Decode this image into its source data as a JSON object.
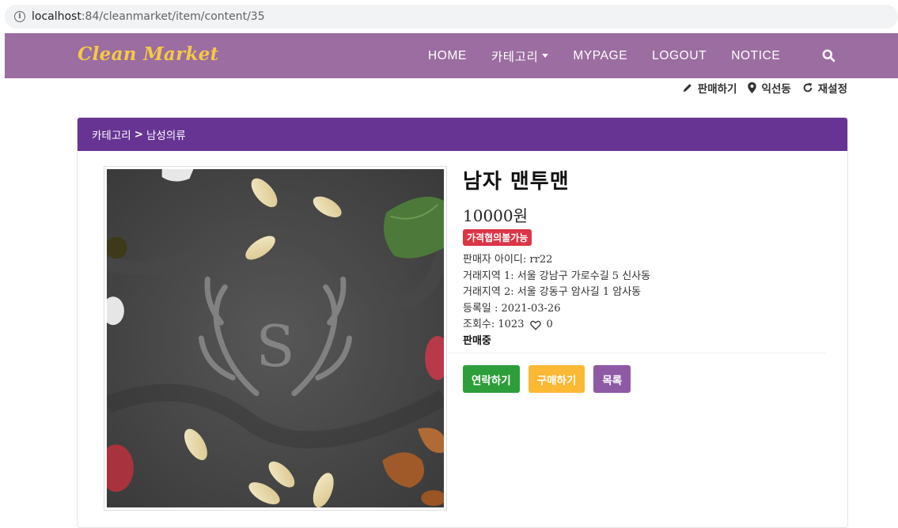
{
  "browser": {
    "url_host": "localhost",
    "url_path": ":84/cleanmarket/item/content/35"
  },
  "navbar": {
    "brand": "Clean Market",
    "links": [
      "HOME",
      "카테고리",
      "MYPAGE",
      "LOGOUT",
      "NOTICE"
    ],
    "bg_color": "#9b6da0",
    "brand_color": "#f6c945"
  },
  "subbar": {
    "sell": "판매하기",
    "location": "익선동",
    "reset": "재설정"
  },
  "breadcrumb": {
    "category": "카테고리",
    "separator": ">",
    "subcategory": "남성의류"
  },
  "item": {
    "title": "남자 맨투맨",
    "price": "10000원",
    "badge": "가격협의불가능",
    "seller": "판매자 아이디: rr22",
    "area1": "거래지역 1: 서울 강남구 가로수길 5 신사동",
    "area2": "거래지역 2: 서울 강동구 암사길 1 암사동",
    "date": "등록일 : 2021-03-26",
    "views": "조회수: 1023",
    "likes": "0",
    "status": "판매중"
  },
  "buttons": {
    "contact": "연락하기",
    "buy": "구매하기",
    "list": "목록"
  },
  "photo": {
    "monogram": "S"
  }
}
